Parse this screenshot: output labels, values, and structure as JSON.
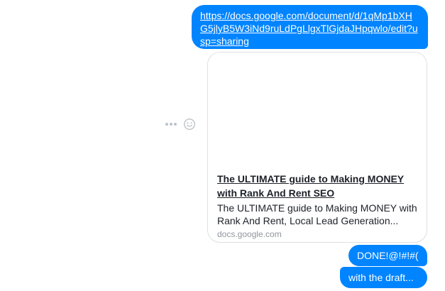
{
  "messages": {
    "link_message": {
      "url": "https://docs.google.com/document/d/1qMp1bXHG5jlyB5W3iNd9ruLdPgLlgxTlGjdaJHpqwlo/edit?usp=sharing"
    },
    "link_preview": {
      "title": "The ULTIMATE guide to Making MONEY with Rank And Rent SEO",
      "description": "The ULTIMATE guide to Making MONEY with Rank And Rent, Local Lead Generation...",
      "domain": "docs.google.com"
    },
    "done_message": {
      "text": "DONE!@!#!#("
    },
    "draft_message": {
      "text": "with the draft..."
    }
  },
  "actions": {
    "more_icon": "more-dots-icon",
    "react_icon": "smiley-icon"
  },
  "colors": {
    "outgoing_bubble": "#0084ff",
    "card_border": "#dddfe2",
    "secondary_text": "#90949c",
    "icon_gray": "#bec2c9"
  }
}
